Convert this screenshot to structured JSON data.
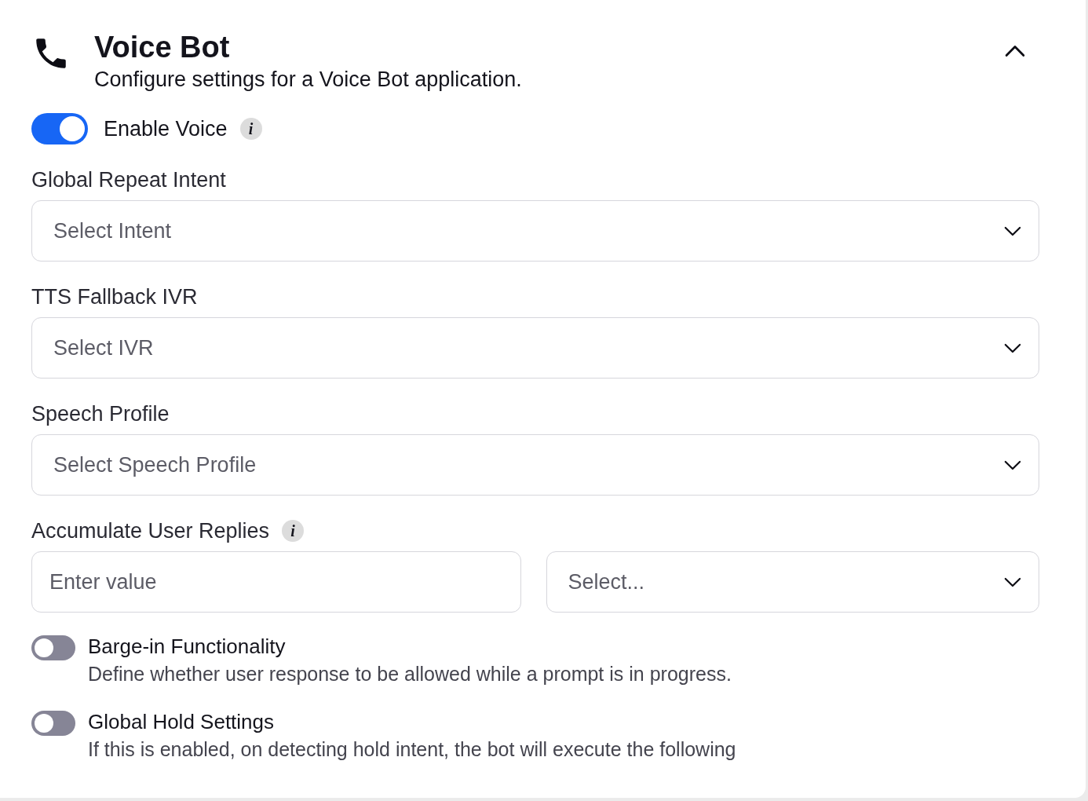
{
  "header": {
    "title": "Voice Bot",
    "subtitle": "Configure settings for a Voice Bot application.",
    "expanded": true
  },
  "enable_voice": {
    "label": "Enable Voice",
    "on": true,
    "info": "i"
  },
  "fields": [
    {
      "label": "Global Repeat Intent",
      "controls": [
        {
          "kind": "select",
          "placeholder": "Select Intent"
        }
      ]
    },
    {
      "label": "TTS Fallback IVR",
      "controls": [
        {
          "kind": "select",
          "placeholder": "Select IVR"
        }
      ]
    },
    {
      "label": "Speech Profile",
      "controls": [
        {
          "kind": "select",
          "placeholder": "Select Speech Profile"
        }
      ]
    },
    {
      "label": "Accumulate User Replies",
      "info": "i",
      "controls": [
        {
          "kind": "input",
          "placeholder": "Enter value"
        },
        {
          "kind": "select",
          "placeholder": "Select..."
        }
      ]
    }
  ],
  "toggles": [
    {
      "label": "Barge-in Functionality",
      "description": "Define whether user response to be allowed while a prompt is in progress.",
      "on": false
    },
    {
      "label": "Global Hold Settings",
      "description": "If this is enabled, on detecting hold intent, the bot will execute the following",
      "on": false
    }
  ]
}
